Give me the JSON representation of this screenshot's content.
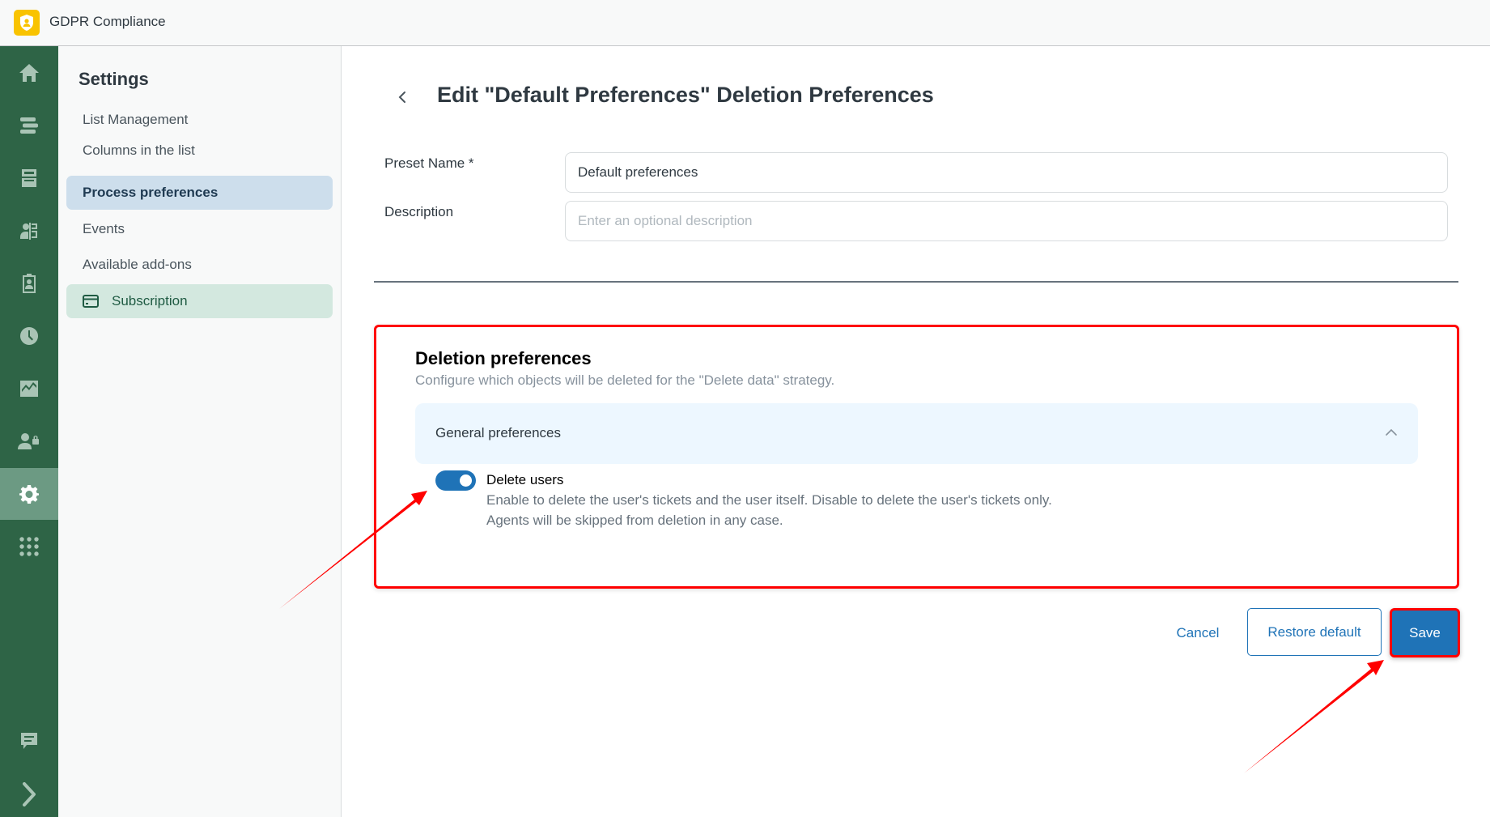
{
  "app": {
    "title": "GDPR Compliance",
    "logo_icon": "shield-user-icon"
  },
  "rail": {
    "items": [
      {
        "name": "home",
        "icon": "home-icon"
      },
      {
        "name": "lists",
        "icon": "list-icon"
      },
      {
        "name": "inbox",
        "icon": "inbox-icon"
      },
      {
        "name": "contacts",
        "icon": "contact-card-icon"
      },
      {
        "name": "clipboard",
        "icon": "clipboard-user-icon"
      },
      {
        "name": "history",
        "icon": "clock-icon"
      },
      {
        "name": "reports",
        "icon": "chart-icon"
      },
      {
        "name": "user-permissions",
        "icon": "user-lock-icon"
      },
      {
        "name": "settings",
        "icon": "gear-icon",
        "active": true
      },
      {
        "name": "apps",
        "icon": "grid-icon"
      }
    ],
    "bottom": [
      {
        "name": "feedback",
        "icon": "chat-icon"
      },
      {
        "name": "expand",
        "icon": "chevron-right-icon"
      }
    ]
  },
  "settings": {
    "title": "Settings",
    "items": [
      {
        "label": "List Management"
      },
      {
        "label": "Columns in the list"
      },
      {
        "label": "Process preferences",
        "active": true
      },
      {
        "label": "Events"
      },
      {
        "label": "Available add-ons"
      },
      {
        "label": "Subscription",
        "icon": "credit-card-icon"
      }
    ]
  },
  "page": {
    "title": "Edit \"Default Preferences\" Deletion Preferences",
    "back_icon": "chevron-left-icon"
  },
  "form": {
    "preset_name_label": "Preset Name *",
    "preset_name_value": "Default preferences",
    "description_label": "Description",
    "description_value": "",
    "description_placeholder": "Enter an optional description"
  },
  "deletion": {
    "title": "Deletion preferences",
    "subtitle": "Configure which objects will be deleted for the \"Delete data\" strategy.",
    "accordion": {
      "label": "General preferences",
      "expanded": true
    },
    "delete_users": {
      "label": "Delete users",
      "enabled": true,
      "hint_line1": "Enable to delete the user's tickets and the user itself. Disable to delete the user's tickets only.",
      "hint_line2": "Agents will be skipped from deletion in any case."
    }
  },
  "actions": {
    "cancel": "Cancel",
    "restore": "Restore default",
    "save": "Save"
  },
  "colors": {
    "rail": "#2e6446",
    "accent": "#1f73b7",
    "annotation": "#ff0000",
    "logo": "#f9c300"
  }
}
